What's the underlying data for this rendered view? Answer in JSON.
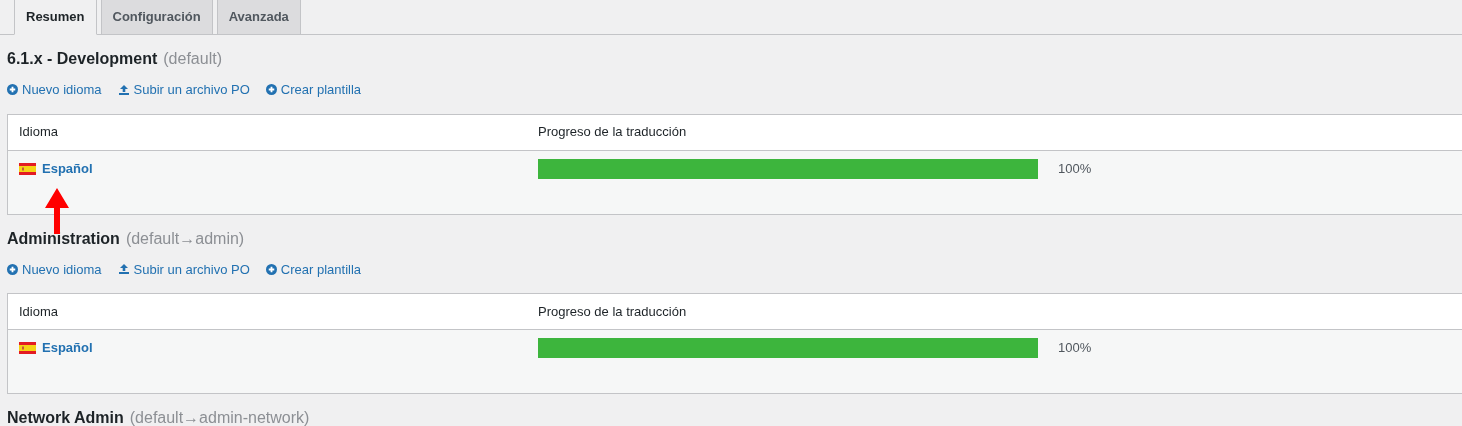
{
  "tabs": [
    {
      "label": "Resumen",
      "selected": true
    },
    {
      "label": "Configuración",
      "selected": false
    },
    {
      "label": "Avanzada",
      "selected": false
    }
  ],
  "sections": [
    {
      "title": "6.1.x - Development",
      "subtitle": "(default)",
      "actions": [
        {
          "kind": "add",
          "label": "Nuevo idioma"
        },
        {
          "kind": "upload",
          "label": "Subir un archivo PO"
        },
        {
          "kind": "add",
          "label": "Crear plantilla"
        }
      ],
      "columns": [
        "Idioma",
        "Progreso de la traducción"
      ],
      "rows": [
        {
          "language": "Español",
          "level": 1,
          "percent": "100%",
          "annotated": true
        }
      ]
    },
    {
      "title": "Administration",
      "subtitle": "(default→admin)",
      "actions": [
        {
          "kind": "add",
          "label": "Nuevo idioma"
        },
        {
          "kind": "upload",
          "label": "Subir un archivo PO"
        },
        {
          "kind": "add",
          "label": "Crear plantilla"
        }
      ],
      "columns": [
        "Idioma",
        "Progreso de la traducción"
      ],
      "rows": [
        {
          "language": "Español",
          "level": 1,
          "percent": "100%",
          "annotated": false
        }
      ]
    },
    {
      "title": "Network Admin",
      "subtitle": "(default→admin-network)"
    }
  ]
}
